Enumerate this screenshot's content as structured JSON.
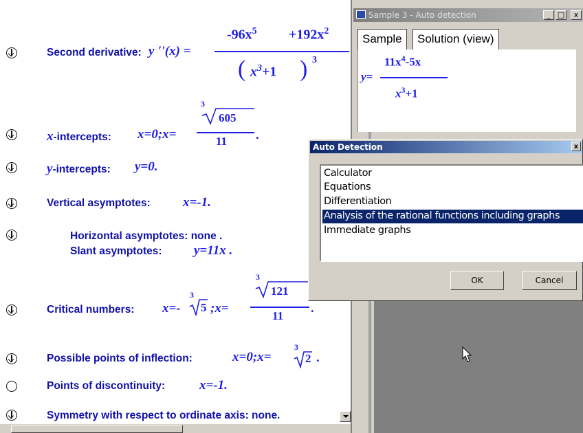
{
  "document": {
    "second_derivative": {
      "label": "Second derivative:",
      "lhs": "y ''(x) =",
      "num_a": "-96x",
      "num_a_exp": "5",
      "num_b": "+192x",
      "num_b_exp": "2",
      "den_inner": "x",
      "den_inner_exp": "3",
      "den_inner_rest": "+1",
      "den_outer_exp": "3"
    },
    "x_intercepts": {
      "label": "-intercepts:",
      "var": "x",
      "expr": "x=0;x=",
      "root_index": "3",
      "radicand": "605",
      "denominator": "11"
    },
    "y_intercepts": {
      "label": "-intercepts:",
      "var": "y",
      "expr": "y=0."
    },
    "vertical_asymptotes": {
      "label": "Vertical asymptotes:",
      "expr": "x=-1."
    },
    "horizontal_asymptotes": {
      "label": "Horizontal asymptotes: none ."
    },
    "slant_asymptotes": {
      "label": "Slant asymptotes:",
      "expr": "y=11x ."
    },
    "critical_numbers": {
      "label": "Critical numbers:",
      "expr_a": "x=-",
      "root_a_index": "3",
      "root_a_radicand": "5",
      "expr_b": ";x=",
      "root_b_index": "3",
      "root_b_radicand": "121",
      "denominator": "11"
    },
    "inflection": {
      "label": "Possible points of inflection:",
      "expr": "x=0;x=",
      "root_index": "3",
      "radicand": "2"
    },
    "discontinuity": {
      "label": "Points of discontinuity:",
      "expr": "x=-1."
    },
    "symmetry": {
      "label": "Symmetry with respect to ordinate axis: none."
    }
  },
  "sample_window": {
    "title": "Sample 3 - Auto detection",
    "minimize": "_",
    "maximize": "□",
    "close": "x",
    "tabs": [
      "Sample",
      "Solution (view)"
    ],
    "function": {
      "lhs": "y=",
      "num": "11x",
      "num_exp": "4",
      "num_rest": "-5x",
      "den": "x",
      "den_exp": "3",
      "den_rest": "+1"
    }
  },
  "dialog": {
    "title": "Auto Detection",
    "close": "x",
    "items": [
      "Calculator",
      "Equations",
      "Differentiation",
      "Analysis of the rational functions including graphs",
      "Immediate graphs"
    ],
    "selected_index": 3,
    "ok_label": "OK",
    "cancel_label": "Cancel"
  }
}
